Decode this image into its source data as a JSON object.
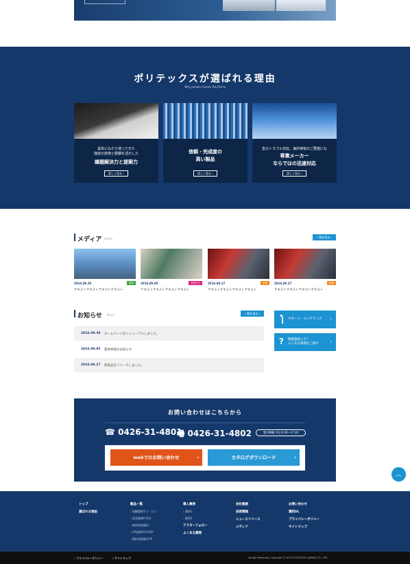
{
  "reasons": {
    "title": "ポリテックスが選ばれる理由",
    "subtitle": "Why people choose PolyTechs",
    "cards": [
      {
        "lead": "長年にわたり培ってきた\n独自の技術と経験を活かした",
        "headline": "課題解決力と提案力",
        "more": "詳しく見る ›"
      },
      {
        "lead": "",
        "headline": "信頼・完成度の\n高い製品",
        "more": "詳しく見る ›"
      },
      {
        "lead": "急なトラブル対応、海外特有のご要望にも",
        "headline": "専業メーカー\nならではの迅速対応",
        "more": "詳しく見る ›"
      }
    ]
  },
  "media": {
    "title": "メディア",
    "title_en": "Media",
    "list_button": "一覧を見る ›",
    "items": [
      {
        "date": "2016.09.20",
        "tag": "事例",
        "tag_color": "#3aa63c",
        "caption": "テキストテキストテキストテキスト"
      },
      {
        "date": "2016.09.05",
        "tag": "お役立ち",
        "tag_color": "#d9237a",
        "caption": "テキストテキストテキストテキスト"
      },
      {
        "date": "2016.08.27",
        "tag": "技術",
        "tag_color": "#f08a1c",
        "caption": "テキストテキストテキストテキスト"
      },
      {
        "date": "2016.08.27",
        "tag": "技術",
        "tag_color": "#f08a1c",
        "caption": "テキストテキストテキストテキスト"
      }
    ]
  },
  "news": {
    "title": "お知らせ",
    "title_en": "News",
    "list_button": "一覧を見る ›",
    "items": [
      {
        "date": "2016.09.30",
        "text": "ホームページをリニューアルしました。"
      },
      {
        "date": "2016.09.05",
        "text": "夏季休暇のお知らせ"
      },
      {
        "date": "2016.08.27",
        "text": "新製品をリリースしました。"
      }
    ]
  },
  "side": {
    "support": "サポート・メンテナンス",
    "faq": "税着連絡って？\nよくある質問をご紹介",
    "arrow": "›"
  },
  "contact": {
    "title": "お問い合わせはこちらから",
    "tel": "0426-31-4801",
    "fax": "0426-31-4802",
    "tel_icon": "☎",
    "fax_icon": "🖷",
    "hours": "受付時間 平日 8:30〜17:30",
    "web_button": "webでのお問い合わせ",
    "catalog_button": "カタログダウンロード",
    "arrow": "›",
    "web_color": "#e0541a",
    "catalog_color": "#2a9ad6"
  },
  "pagetop": "︿",
  "footer": {
    "columns": [
      {
        "head": "トップ",
        "subs": [],
        "head2": "選ばれる理由",
        "subs2": []
      },
      {
        "head": "製品一覧",
        "subs": [
          "› 高難電線サブ・ロン",
          "› 低発電線P-ESA",
          "› 樹体性能器料",
          "› UP混線POLYSEP",
          "› 製料収録器rESP"
        ]
      },
      {
        "head": "導入事例",
        "subs": [
          "› 事例1",
          "› 事例2"
        ],
        "head2": "アフターフォロー",
        "head3": "よくある質問"
      },
      {
        "head": "会社概要",
        "head2": "技術情報",
        "head3": "ニュースリリース",
        "head4": "メディア"
      },
      {
        "head": "お問い合わせ",
        "head2": "資料DL",
        "head3": "プライバシーポリシー",
        "head4": "サイトマップ"
      }
    ]
  },
  "bottom": {
    "privacy": "› プライバシーポリシー",
    "sitemap": "› サイトマップ",
    "copyright": "Allright Reserved, Copyright © 2015 POLYTECHS (JAPAN) CO., LTD."
  }
}
